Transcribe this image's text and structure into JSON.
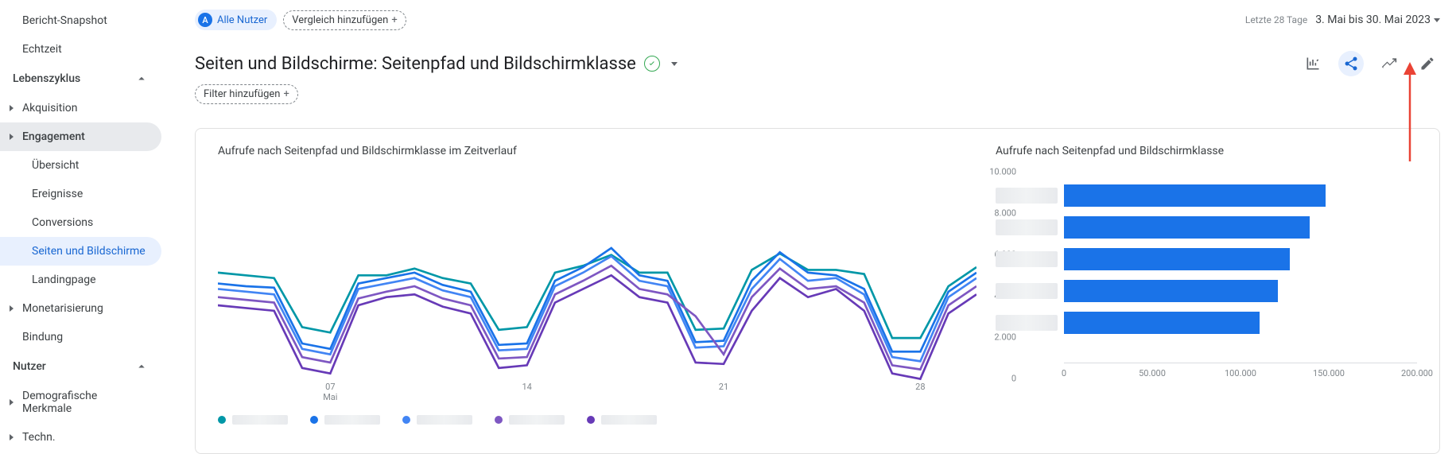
{
  "sidebar": {
    "items": [
      {
        "label": "Bericht-Snapshot",
        "type": "item"
      },
      {
        "label": "Echtzeit",
        "type": "item"
      },
      {
        "label": "Lebenszyklus",
        "type": "section"
      },
      {
        "label": "Akquisition",
        "type": "item-caret"
      },
      {
        "label": "Engagement",
        "type": "item-caret-active"
      },
      {
        "label": "Übersicht",
        "type": "sub"
      },
      {
        "label": "Ereignisse",
        "type": "sub"
      },
      {
        "label": "Conversions",
        "type": "sub"
      },
      {
        "label": "Seiten und Bildschirme",
        "type": "sub-selected"
      },
      {
        "label": "Landingpage",
        "type": "sub"
      },
      {
        "label": "Monetarisierung",
        "type": "item-caret"
      },
      {
        "label": "Bindung",
        "type": "item"
      },
      {
        "label": "Nutzer",
        "type": "section"
      },
      {
        "label": "Demografische Merkmale",
        "type": "item-caret"
      },
      {
        "label": "Techn.",
        "type": "item-caret"
      }
    ]
  },
  "topbar": {
    "all_users_badge": "A",
    "all_users_label": "Alle Nutzer",
    "compare_label": "Vergleich hinzufügen",
    "date_label": "Letzte 28 Tage",
    "date_range": "3. Mai bis 30. Mai 2023"
  },
  "header": {
    "title": "Seiten und Bildschirme: Seitenpfad und Bildschirmklasse",
    "filter_label": "Filter hinzufügen"
  },
  "chart_data": [
    {
      "type": "line",
      "title": "Aufrufe nach Seitenpfad und Bildschirmklasse im Zeitverlauf",
      "xlabel": "Mai",
      "ylabel": "",
      "ylim": [
        0,
        10000
      ],
      "y_ticks": [
        0,
        2000,
        4000,
        6000,
        8000,
        10000
      ],
      "x_ticks": [
        "07",
        "14",
        "21",
        "28"
      ],
      "x": [
        3,
        4,
        5,
        6,
        7,
        8,
        9,
        10,
        11,
        12,
        13,
        14,
        15,
        16,
        17,
        18,
        19,
        20,
        21,
        22,
        23,
        24,
        25,
        26,
        27,
        28,
        29,
        30
      ],
      "series": [
        {
          "name": "series-1",
          "color": "#0097a7",
          "values": [
            6300,
            6200,
            6100,
            4300,
            4100,
            6200,
            6200,
            6450,
            6100,
            5900,
            4200,
            4300,
            6300,
            6550,
            6950,
            6300,
            6300,
            4200,
            4250,
            6400,
            7000,
            6400,
            6400,
            6250,
            3900,
            3900,
            5800,
            6500
          ]
        },
        {
          "name": "series-2",
          "color": "#1a73e8",
          "values": [
            5900,
            5800,
            5750,
            3700,
            3500,
            5900,
            6100,
            6300,
            5850,
            5600,
            3650,
            3700,
            6000,
            6500,
            7200,
            6200,
            6000,
            3750,
            3800,
            6000,
            7050,
            6300,
            6200,
            5700,
            3400,
            3400,
            5600,
            6300
          ]
        },
        {
          "name": "series-3",
          "color": "#4285f4",
          "values": [
            5700,
            5600,
            5500,
            3500,
            3300,
            5700,
            5900,
            6100,
            5650,
            5400,
            3450,
            3500,
            5800,
            6300,
            6900,
            6000,
            5800,
            3550,
            3600,
            5700,
            6800,
            6000,
            6100,
            5500,
            3200,
            3050,
            5400,
            6100
          ]
        },
        {
          "name": "series-4",
          "color": "#7e57c2",
          "values": [
            5400,
            5300,
            5200,
            3200,
            3000,
            5350,
            5600,
            5800,
            5350,
            5100,
            3150,
            3200,
            5500,
            6000,
            6550,
            5700,
            5500,
            4700,
            3300,
            5400,
            6450,
            5700,
            5800,
            5200,
            2900,
            2750,
            5100,
            5800
          ]
        },
        {
          "name": "series-5",
          "color": "#673ab7",
          "values": [
            5100,
            5000,
            4900,
            2800,
            2600,
            5100,
            5400,
            5500,
            5050,
            4800,
            2800,
            2900,
            5200,
            5700,
            6200,
            5400,
            5200,
            3000,
            2950,
            4900,
            6100,
            5400,
            5700,
            4900,
            2600,
            2400,
            4800,
            5500
          ]
        }
      ]
    },
    {
      "type": "bar",
      "title": "Aufrufe nach Seitenpfad und Bildschirmklasse",
      "orientation": "horizontal",
      "xlabel": "",
      "ylabel": "",
      "xlim": [
        0,
        200000
      ],
      "x_ticks": [
        0,
        50000,
        100000,
        150000,
        200000
      ],
      "x_tick_labels": [
        "0",
        "50.000",
        "100.000",
        "150.000",
        "200.000"
      ],
      "categories": [
        "",
        "",
        "",
        "",
        ""
      ],
      "values": [
        148000,
        139000,
        128000,
        121000,
        111000
      ],
      "color": "#1a73e8"
    }
  ]
}
